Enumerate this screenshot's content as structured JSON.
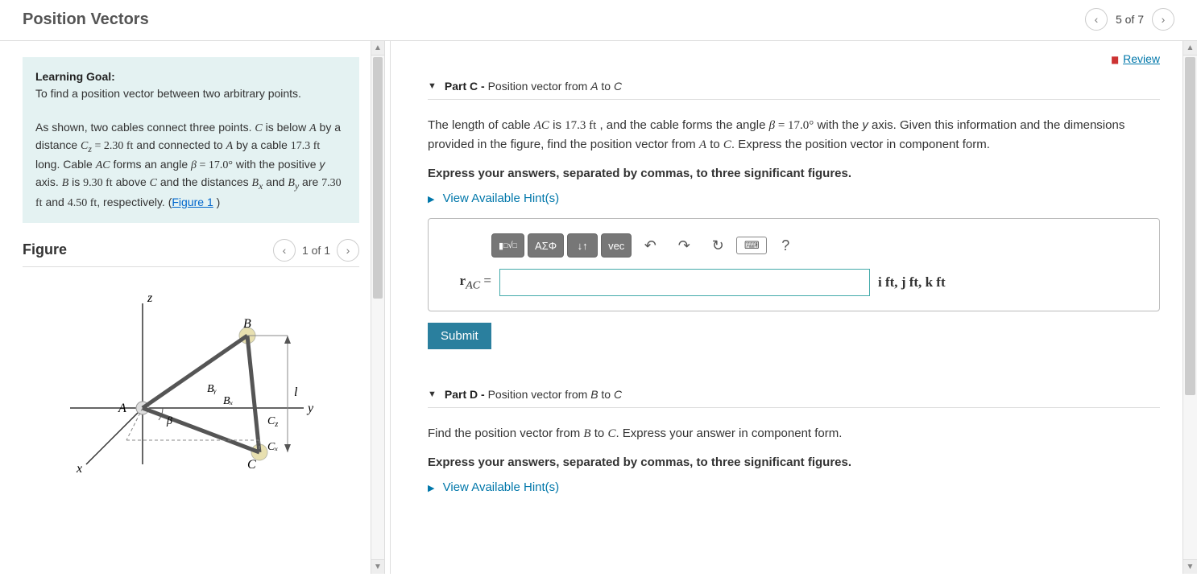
{
  "header": {
    "title": "Position Vectors",
    "position": "5 of 7"
  },
  "left": {
    "goal_label": "Learning Goal:",
    "goal_text": "To find a position vector between two arbitrary points.",
    "problem_html": "As shown, two cables connect three points. <span class='serif'><i>C</i></span> is below <span class='serif'><i>A</i></span>  by a distance <span class='serif'><i>C<sub>z</sub></i> = 2.30 ft</span> and connected to <span class='serif'><i>A</i></span> by a cable <span class='serif'>17.3 ft</span> long. Cable <span class='serif'><i>AC</i></span> forms an angle <span class='serif'><i>β</i> = 17.0°</span> with the positive <i>y</i> axis. <span class='serif'><i>B</i></span> is <span class='serif'>9.30 ft</span> above <span class='serif'><i>C</i></span> and the distances <span class='serif'><i>B<sub>x</sub></i></span> and <span class='serif'><i>B<sub>y</sub></i></span> are <span class='serif'>7.30 ft</span> and <span class='serif'>4.50 ft</span>, respectively. (<a class='figlink' href='#'>Figure 1</a> )",
    "figure_label": "Figure",
    "figure_position": "1 of 1",
    "figure_labels": {
      "z": "z",
      "y": "y",
      "x": "x",
      "A": "A",
      "B": "B",
      "C": "C",
      "Bx": "Bₓ",
      "By": "Bᵧ",
      "Cx": "Cₓ",
      "Cz": "C_z",
      "l": "l",
      "beta": "β"
    }
  },
  "right": {
    "review": "Review",
    "partC": {
      "label": "Part C",
      "title": "Position vector from A to C",
      "text_html": "The length of cable <span class='serif'><i>AC</i></span> is <span class='serif'>17.3 ft</span> , and the cable forms the angle <span class='serif'><i>β</i> = 17.0°</span> with the <i>y</i> axis. Given this information and the dimensions provided in the figure, find the position vector from <span class='serif'><i>A</i></span> to <span class='serif'><i>C</i></span>. Express the position vector in component form.",
      "instructions": "Express your answers, separated by commas, to three significant figures.",
      "hints": "View Available Hint(s)",
      "lhs_html": "<b>r</b><sub><i>AC</i></sub> =",
      "units_html": "<b>i</b> ft, <b>j</b> ft, <b>k</b> ft",
      "submit": "Submit",
      "toolbar": {
        "templates": "▮√▯",
        "greek": "ΑΣΦ",
        "sort": "↓↑",
        "vec": "vec",
        "undo": "↶",
        "redo": "↷",
        "reset": "↻",
        "keyboard": "⌨",
        "help": "?"
      }
    },
    "partD": {
      "label": "Part D",
      "title": "Position vector from B to C",
      "text_html": "Find the position vector from <span class='serif'><i>B</i></span> to <span class='serif'><i>C</i></span>. Express your answer in component form.",
      "instructions": "Express your answers, separated by commas, to three significant figures.",
      "hints": "View Available Hint(s)"
    }
  }
}
